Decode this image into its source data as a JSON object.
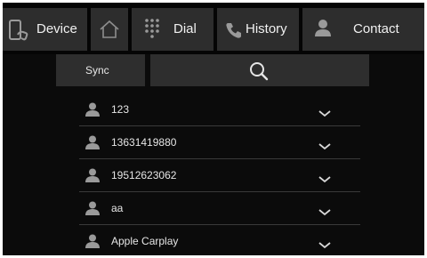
{
  "nav": {
    "device": {
      "label": "Device",
      "icon": "phone-device-icon"
    },
    "home": {
      "icon": "home-icon"
    },
    "dial": {
      "label": "Dial",
      "icon": "keypad-icon"
    },
    "history": {
      "label": "History",
      "icon": "phone-handset-icon"
    },
    "contact": {
      "label": "Contact",
      "icon": "person-icon"
    }
  },
  "toolbar": {
    "sync_label": "Sync",
    "search_icon": "search-icon"
  },
  "contacts": [
    {
      "name": "123"
    },
    {
      "name": "13631419880"
    },
    {
      "name": "19512623062"
    },
    {
      "name": "aa"
    },
    {
      "name": "Apple Carplay"
    }
  ],
  "colors": {
    "background": "#0b0b0b",
    "button": "#2d2d2d",
    "text": "#f0f0f0",
    "icon": "#9a9a9a"
  }
}
